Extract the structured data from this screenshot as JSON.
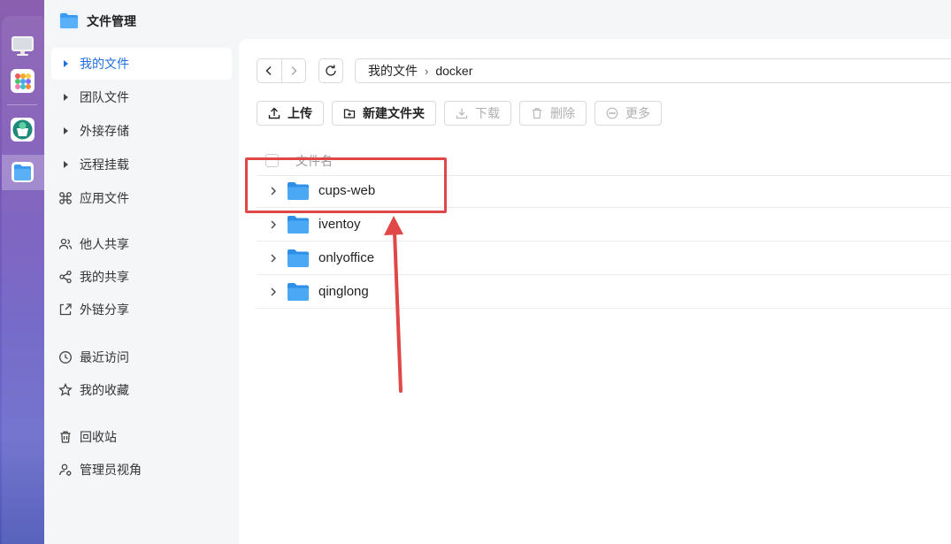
{
  "app": {
    "title": "文件管理"
  },
  "dock": {
    "icons": [
      "desktop-icon",
      "apps-grid-icon",
      "store-icon",
      "file-manager-icon"
    ],
    "active": "file-manager-icon"
  },
  "sidebar": {
    "items": [
      {
        "label": "我的文件",
        "icon": "caret-right",
        "active": true
      },
      {
        "label": "团队文件",
        "icon": "caret-right",
        "active": false
      },
      {
        "label": "外接存储",
        "icon": "caret-right",
        "active": false
      },
      {
        "label": "远程挂载",
        "icon": "caret-right",
        "active": false
      },
      {
        "label": "应用文件",
        "icon": "command-icon",
        "active": false
      },
      {
        "label": "他人共享",
        "icon": "users-icon",
        "active": false
      },
      {
        "label": "我的共享",
        "icon": "share-icon",
        "active": false
      },
      {
        "label": "外链分享",
        "icon": "external-link-icon",
        "active": false
      },
      {
        "label": "最近访问",
        "icon": "clock-icon",
        "active": false
      },
      {
        "label": "我的收藏",
        "icon": "star-icon",
        "active": false
      },
      {
        "label": "回收站",
        "icon": "trash-icon",
        "active": false
      },
      {
        "label": "管理员视角",
        "icon": "admin-icon",
        "active": false
      }
    ]
  },
  "path": {
    "root": "我的文件",
    "separator": "›",
    "current": "docker"
  },
  "toolbar": {
    "upload": "上传",
    "new_folder": "新建文件夹",
    "download": "下载",
    "delete": "删除",
    "more": "更多"
  },
  "table": {
    "header_name": "文件名",
    "rows": [
      {
        "name": "cups-web"
      },
      {
        "name": "iventoy"
      },
      {
        "name": "onlyoffice"
      },
      {
        "name": "qinglong"
      }
    ]
  },
  "colors": {
    "accent": "#1f6fe0",
    "annotation": "#e04848",
    "folder": "#3a9bf0"
  }
}
